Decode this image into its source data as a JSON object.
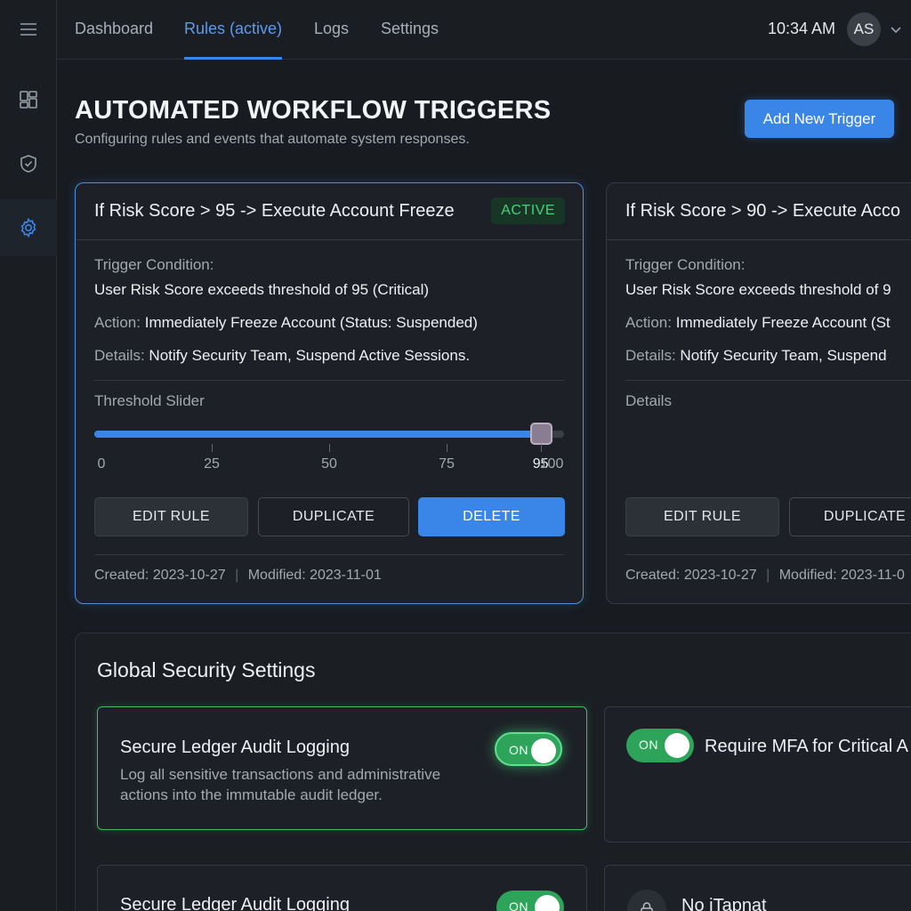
{
  "nav": {
    "tabs": [
      {
        "label": "Dashboard"
      },
      {
        "label": "Rules (active)"
      },
      {
        "label": "Logs"
      },
      {
        "label": "Settings"
      }
    ],
    "time": "10:34 AM",
    "avatar_initials": "AS"
  },
  "header": {
    "title": "AUTOMATED WORKFLOW TRIGGERS",
    "subtitle": "Configuring rules and events that automate system responses.",
    "add_button": "Add New Trigger"
  },
  "triggers": [
    {
      "title": "If Risk Score > 95 -> Execute Account Freeze",
      "status": "ACTIVE",
      "condition_label": "Trigger Condition:",
      "condition_value": "User Risk Score exceeds threshold of 95 (Critical)",
      "action_label": "Action:",
      "action_value": "Immediately Freeze Account (Status: Suspended)",
      "details_label": "Details:",
      "details_value": "Notify Security Team, Suspend Active Sessions.",
      "slider_label": "Threshold Slider",
      "slider_value": 95,
      "slider_ticks": [
        "0",
        "25",
        "50",
        "75",
        "95",
        "100"
      ],
      "buttons": {
        "edit": "EDIT RULE",
        "duplicate": "DUPLICATE",
        "delete": "DELETE"
      },
      "created": "Created: 2023-10-27",
      "modified": "Modified: 2023-11-01"
    },
    {
      "title": "If Risk Score > 90 -> Execute Acco",
      "condition_label": "Trigger Condition:",
      "condition_value": "User Risk Score exceeds threshold of 9",
      "action_label": "Action:",
      "action_value": "Immediately Freeze Account (St",
      "details_label": "Details:",
      "details_value": "Notify Security Team, Suspend",
      "section_label": "Details",
      "buttons": {
        "edit": "EDIT RULE",
        "duplicate": "DUPLICATE"
      },
      "created": "Created: 2023-10-27",
      "modified": "Modified: 2023-11-0"
    }
  ],
  "global_settings": {
    "title": "Global Security Settings",
    "items": [
      {
        "title": "Secure Ledger Audit Logging",
        "description": "Log all sensitive transactions and administrative actions into the immutable audit ledger.",
        "toggle": "ON"
      },
      {
        "title": "Require MFA for Critical A",
        "toggle": "ON"
      },
      {
        "title": "Secure Ledger Audit Logging",
        "toggle": "ON"
      },
      {
        "title": "No iTapnat"
      }
    ]
  },
  "colors": {
    "accent": "#3a86e8",
    "success": "#2ea35a",
    "background": "#181b20"
  }
}
